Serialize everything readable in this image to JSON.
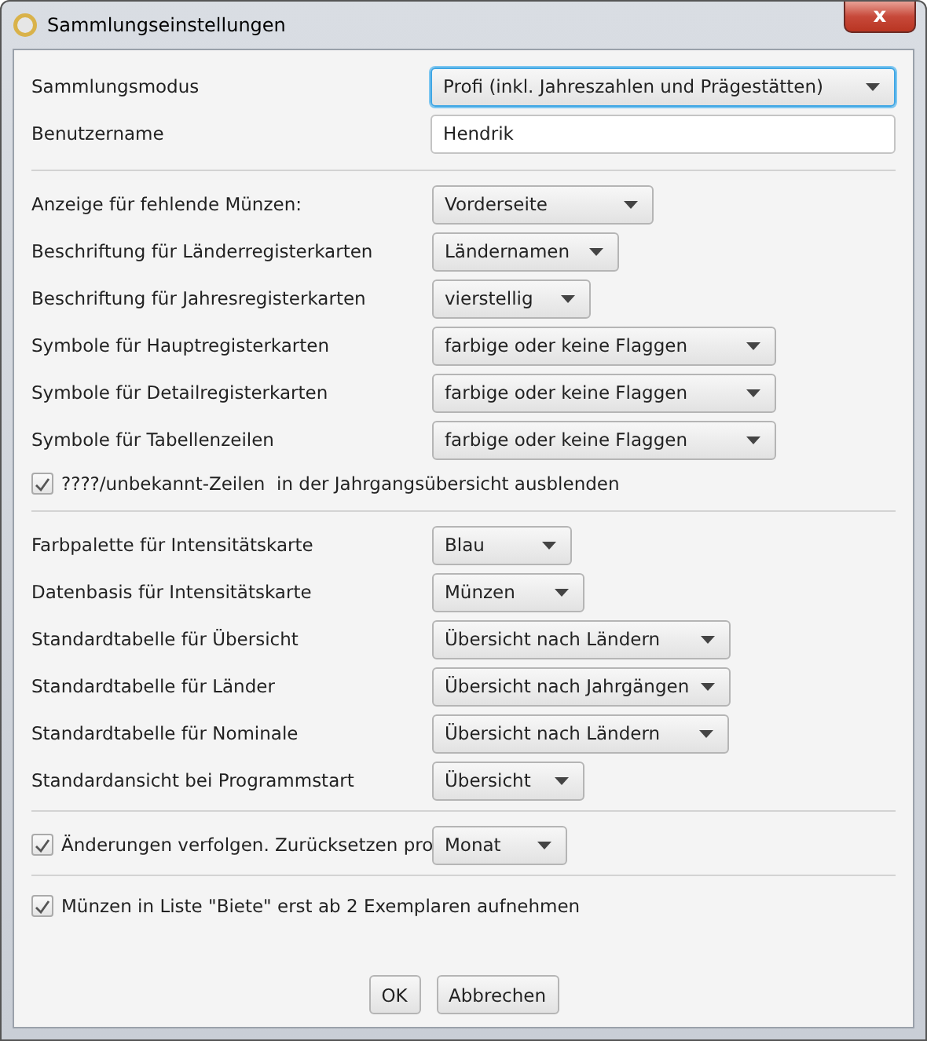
{
  "window": {
    "title": "Sammlungseinstellungen",
    "close_label": "x"
  },
  "sections": [
    {
      "rows": [
        {
          "kind": "dropdown",
          "label": "Sammlungsmodus",
          "value": "Profi (inkl. Jahreszahlen und Prägestätten)",
          "focused": true
        },
        {
          "kind": "text",
          "label": "Benutzername",
          "value": "Hendrik"
        }
      ]
    },
    {
      "rows": [
        {
          "kind": "dropdown",
          "label": "Anzeige für fehlende Münzen:",
          "value": "Vorderseite",
          "focused": false
        },
        {
          "kind": "dropdown",
          "label": "Beschriftung für Länderregisterkarten",
          "value": "Ländernamen",
          "focused": false
        },
        {
          "kind": "dropdown",
          "label": "Beschriftung für Jahresregisterkarten",
          "value": "vierstellig",
          "focused": false
        },
        {
          "kind": "dropdown",
          "label": "Symbole für Hauptregisterkarten",
          "value": "farbige oder keine Flaggen",
          "focused": false
        },
        {
          "kind": "dropdown",
          "label": "Symbole für Detailregisterkarten",
          "value": "farbige oder keine Flaggen",
          "focused": false
        },
        {
          "kind": "dropdown",
          "label": "Symbole für Tabellenzeilen",
          "value": "farbige oder keine Flaggen",
          "focused": false
        },
        {
          "kind": "checkbox",
          "label": "????/unbekannt-Zeilen  in der Jahrgangsübersicht ausblenden",
          "checked": true
        }
      ]
    },
    {
      "rows": [
        {
          "kind": "dropdown",
          "label": "Farbpalette für Intensitätskarte",
          "value": "Blau",
          "focused": false
        },
        {
          "kind": "dropdown",
          "label": "Datenbasis für Intensitätskarte",
          "value": "Münzen",
          "focused": false
        },
        {
          "kind": "dropdown",
          "label": "Standardtabelle für Übersicht",
          "value": "Übersicht nach Ländern",
          "focused": false
        },
        {
          "kind": "dropdown",
          "label": "Standardtabelle für Länder",
          "value": "Übersicht nach Jahrgängen",
          "focused": false
        },
        {
          "kind": "dropdown",
          "label": "Standardtabelle für Nominale",
          "value": "Übersicht nach Ländern",
          "focused": false
        },
        {
          "kind": "dropdown",
          "label": "Standardansicht bei Programmstart",
          "value": "Übersicht",
          "focused": false
        }
      ]
    },
    {
      "rows": [
        {
          "kind": "checkbox_dropdown",
          "label": "Änderungen verfolgen. Zurücksetzen pro",
          "checked": true,
          "value": "Monat",
          "focused": false
        }
      ]
    },
    {
      "rows": [
        {
          "kind": "checkbox",
          "label": "Münzen in Liste \"Biete\" erst ab 2 Exemplaren aufnehmen",
          "checked": true
        }
      ]
    }
  ],
  "buttons": [
    "OK",
    "Abbrechen"
  ]
}
